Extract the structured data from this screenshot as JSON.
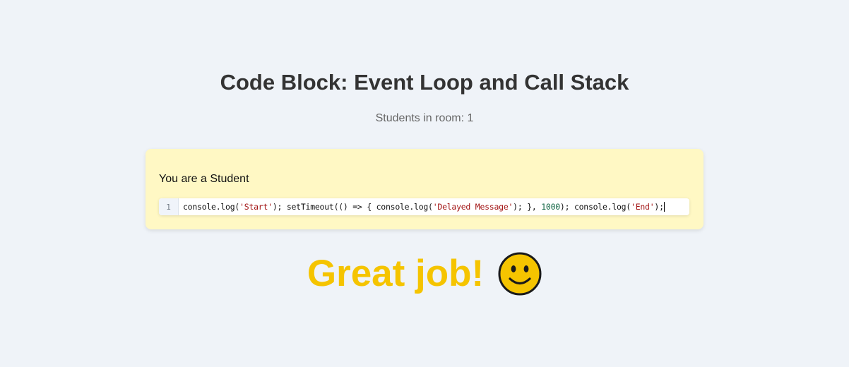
{
  "page": {
    "title": "Code Block: Event Loop and Call Stack",
    "students_label": "Students in room: 1"
  },
  "panel": {
    "role_label": "You are a Student",
    "background_color": "#fff8c4"
  },
  "editor": {
    "line_number": "1",
    "tokens": [
      {
        "text": "console.log(",
        "type": "plain"
      },
      {
        "text": "'Start'",
        "type": "string"
      },
      {
        "text": "); setTimeout(() => { console.log(",
        "type": "plain"
      },
      {
        "text": "'Delayed Message'",
        "type": "string"
      },
      {
        "text": "); }, ",
        "type": "plain"
      },
      {
        "text": "1000",
        "type": "number"
      },
      {
        "text": "); console.log(",
        "type": "plain"
      },
      {
        "text": "'End'",
        "type": "string"
      },
      {
        "text": ");",
        "type": "plain"
      }
    ]
  },
  "success": {
    "message": "Great job!",
    "icon": "smiley-face-icon",
    "color": "#f5c400"
  }
}
